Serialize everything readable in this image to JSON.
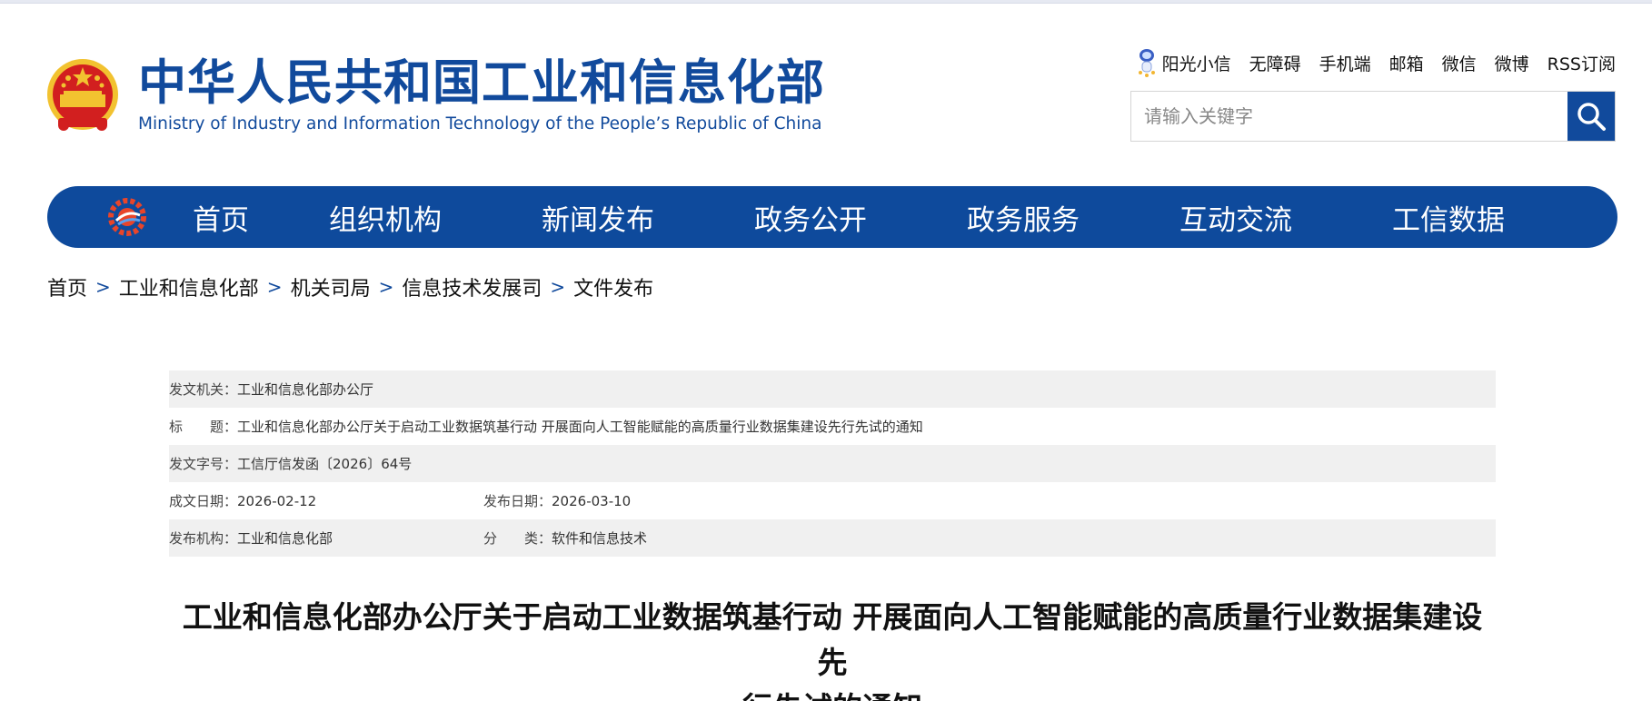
{
  "header": {
    "site_title_cn": "中华人民共和国工业和信息化部",
    "site_title_en": "Ministry of Industry and Information Technology of the People’s Republic of China",
    "toplinks": [
      "阳光小信",
      "无障碍",
      "手机端",
      "邮箱",
      "微信",
      "微博",
      "RSS订阅"
    ],
    "search_placeholder": "请输入关键字"
  },
  "nav": {
    "items": [
      "首页",
      "组织机构",
      "新闻发布",
      "政务公开",
      "政务服务",
      "互动交流",
      "工信数据"
    ]
  },
  "breadcrumb": [
    "首页",
    "工业和信息化部",
    "机关司局",
    "信息技术发展司",
    "文件发布"
  ],
  "breadcrumb_separator": ">",
  "meta": {
    "issuer_label": "发文机关：",
    "issuer_value": "工业和信息化部办公厅",
    "title_label": "标　　题：",
    "title_value": "工业和信息化部办公厅关于启动工业数据筑基行动 开展面向人工智能赋能的高质量行业数据集建设先行先试的通知",
    "doc_no_label": "发文字号：",
    "doc_no_value": "工信厅信发函〔2026〕64号",
    "created_label": "成文日期：",
    "created_value": "2026-02-12",
    "published_label": "发布日期：",
    "published_value": "2026-03-10",
    "org_label": "发布机构：",
    "org_value": "工业和信息化部",
    "category_label": "分　　类：",
    "category_value": "软件和信息技术"
  },
  "article": {
    "title_line1": "工业和信息化部办公厅关于启动工业数据筑基行动 开展面向人工智能赋能的高质量行业数据集建设先",
    "title_line2": "行先试的通知"
  },
  "colors": {
    "brand_blue": "#114a9c",
    "shade_gray": "#f0f0f0",
    "emblem_red": "#d21f1f",
    "emblem_gold": "#f2c230"
  }
}
